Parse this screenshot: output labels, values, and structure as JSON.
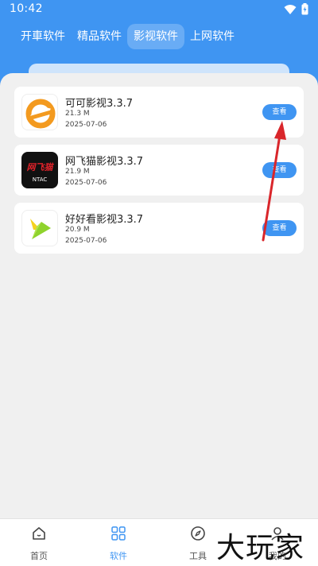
{
  "status_bar": {
    "time": "10:42"
  },
  "tabs": [
    {
      "label": "开車软件"
    },
    {
      "label": "精品软件"
    },
    {
      "label": "影视软件",
      "active": true
    },
    {
      "label": "上网软件"
    }
  ],
  "apps": [
    {
      "name": "可可影视3.3.7",
      "size": "21.3 M",
      "date": "2025-07-06",
      "button": "查看",
      "icon": "keke-logo-icon"
    },
    {
      "name": "网飞猫影视3.3.7",
      "size": "21.9 M",
      "date": "2025-07-06",
      "button": "查看",
      "icon": "netflix-cat-logo-icon",
      "logo_text": "网飞猫",
      "logo_subtext": "NTAC"
    },
    {
      "name": "好好看影视3.3.7",
      "size": "20.9 M",
      "date": "2025-07-06",
      "button": "查看",
      "icon": "haohaokan-logo-icon"
    }
  ],
  "bottom_nav": [
    {
      "label": "首页",
      "icon": "home-icon"
    },
    {
      "label": "软件",
      "icon": "grid-icon",
      "active": true
    },
    {
      "label": "工具",
      "icon": "compass-icon"
    },
    {
      "label": "我的",
      "icon": "user-icon"
    }
  ],
  "watermark": "大玩家",
  "colors": {
    "accent": "#3f95f2",
    "annotation_arrow": "#d9262b"
  }
}
